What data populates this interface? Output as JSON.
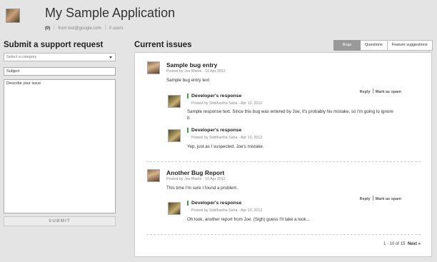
{
  "app": {
    "title": "My Sample Application",
    "meta": {
      "count": "(0)",
      "email": "from test@google.com",
      "users": "0 users"
    }
  },
  "support": {
    "title": "Submit a support request",
    "category_placeholder": "Select a category",
    "subject_placeholder": "Subject",
    "issue_placeholder": "Describe your issue",
    "submit_label": "SUBMIT"
  },
  "issues": {
    "title": "Current issues",
    "tabs": [
      "Bugs",
      "Questions",
      "Feature suggestions"
    ],
    "items": [
      {
        "title": "Sample bug entry",
        "posted": "Posted by Joe Marini - 10 Apr 2012",
        "text": "Sample bug entry text",
        "reply": "Reply",
        "spam": "Mark as spam",
        "responses": [
          {
            "title": "Developer's response",
            "posted": "Posted by Siddhartha Saha - Apr 10, 2012",
            "text": "Sample response text. Since this bug was entered by Joe, it's probably his mistake, so I'm going to ignore it."
          },
          {
            "title": "Developer's response",
            "posted": "Posted by Siddhartha Saha - Apr 10, 2012",
            "text": "Yep, just as I suspected, Joe's mistake."
          }
        ]
      },
      {
        "title": "Another Bug Report",
        "posted": "Posted by Joe Marini - 10 Apr 2012",
        "text": "This time I'm sure I found a problem.",
        "reply": "Reply",
        "spam": "Mark as spam",
        "responses": [
          {
            "title": "Developer's response",
            "posted": "Posted by Siddhartha Saha - Apr 10, 2012",
            "text": "Oh look, another report from Joe. (Sigh) guess I'll take a look..."
          }
        ]
      }
    ],
    "pager": {
      "range": "1 - 10 of 15",
      "next": "Next »"
    }
  }
}
